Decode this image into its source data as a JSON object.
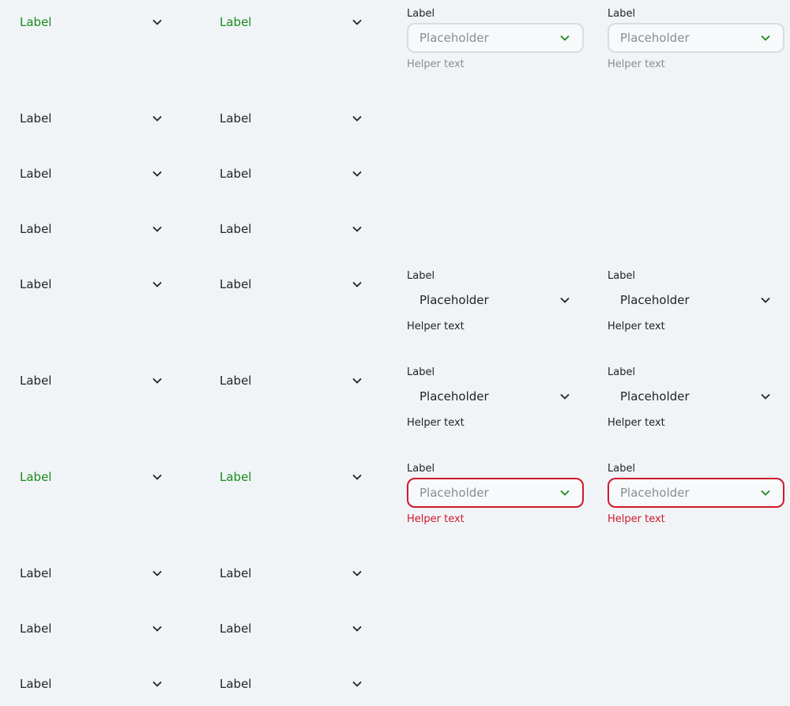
{
  "dropdowns": {
    "row1": {
      "label": "Label"
    },
    "row2": {
      "label": "Label"
    },
    "row3": {
      "label": "Label"
    },
    "row4": {
      "label": "Label"
    },
    "row5": {
      "label": "Label"
    },
    "row6": {
      "label": "Label"
    },
    "row7": {
      "label": "Label"
    },
    "row8": {
      "label": "Label"
    },
    "row9": {
      "label": "Label"
    },
    "row10": {
      "label": "Label"
    }
  },
  "selects": {
    "label": "Label",
    "placeholder": "Placeholder",
    "helper": "Helper text"
  },
  "colors": {
    "active_green": "#1b8a1b",
    "error_red": "#d1192b",
    "background": "#f0f4f7"
  }
}
